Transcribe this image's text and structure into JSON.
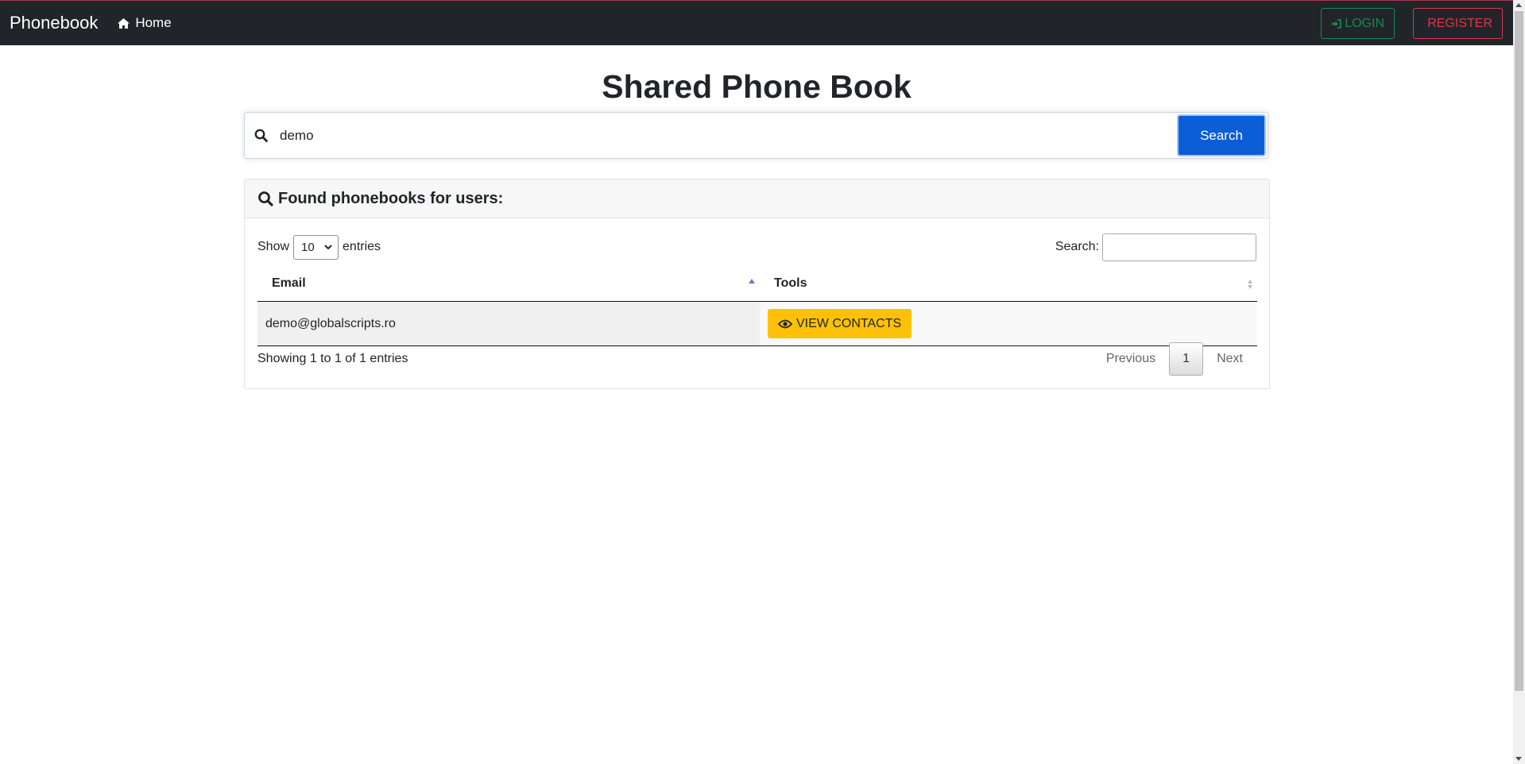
{
  "navbar": {
    "brand": "Phonebook",
    "home_label": "Home",
    "login_label": "LOGIN",
    "register_label": "REGISTER"
  },
  "page": {
    "title": "Shared Phone Book"
  },
  "search": {
    "value": "demo",
    "button_label": "Search"
  },
  "results": {
    "header": "Found phonebooks for users:",
    "length": {
      "show_label": "Show",
      "selected": "10",
      "entries_label": "entries"
    },
    "filter_label": "Search:",
    "columns": [
      "Email",
      "Tools"
    ],
    "rows": [
      {
        "email": "demo@globalscripts.ro",
        "action_label": "VIEW CONTACTS"
      }
    ],
    "info": "Showing 1 to 1 of 1 entries",
    "pagination": {
      "previous": "Previous",
      "current": "1",
      "next": "Next"
    }
  },
  "icons": {
    "home": "home-icon",
    "login": "sign-in-icon",
    "register": "plus-icon",
    "search": "search-icon",
    "view": "eye-icon"
  },
  "colors": {
    "navbar_bg": "#212529",
    "login": "#198754",
    "register": "#dc3545",
    "primary": "#0b5ed7",
    "warning": "#ffc107"
  }
}
